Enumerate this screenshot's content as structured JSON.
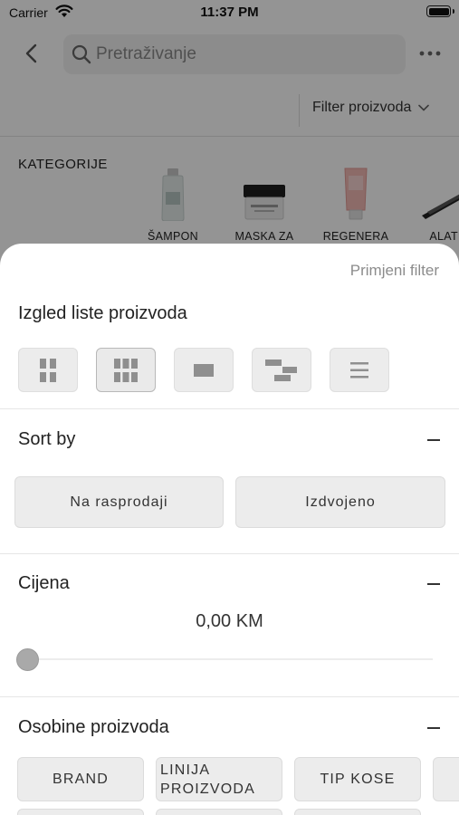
{
  "status_bar": {
    "carrier": "Carrier",
    "time": "11:37 PM"
  },
  "header": {
    "search_placeholder": "Pretraživanje",
    "filter_dropdown_label": "Filter proizvoda"
  },
  "categories": {
    "title": "KATEGORIJE",
    "items": [
      {
        "label": "ŠAMPON",
        "icon": "shampoo-bottle-icon"
      },
      {
        "label": "MASKA ZA",
        "icon": "hair-mask-jar-icon"
      },
      {
        "label": "REGENERA",
        "icon": "conditioner-tube-icon"
      },
      {
        "label": "ALATI",
        "icon": "hair-straightener-icon"
      }
    ]
  },
  "sheet": {
    "apply_label": "Primjeni filter",
    "layout_title": "Izgled liste proizvoda",
    "layout_options": [
      {
        "icon": "grid-2-icon",
        "selected": false
      },
      {
        "icon": "grid-3-icon",
        "selected": true
      },
      {
        "icon": "single-card-icon",
        "selected": false
      },
      {
        "icon": "list-detail-icon",
        "selected": false
      },
      {
        "icon": "list-lines-icon",
        "selected": false
      }
    ],
    "sort": {
      "title": "Sort by",
      "options": [
        "Na rasprodaji",
        "Izdvojeno"
      ]
    },
    "price": {
      "title": "Cijena",
      "value": "0,00 KM",
      "slider_fraction": 0
    },
    "attributes": {
      "title": "Osobine proizvoda",
      "options": [
        "BRAND",
        "LINIJA PROIZVODA",
        "TIP KOSE"
      ]
    }
  },
  "colors": {
    "scrim": "#000000",
    "button_bg": "#ececec",
    "slider_thumb": "#a9a9a9",
    "muted_text": "#8c8c8c"
  }
}
